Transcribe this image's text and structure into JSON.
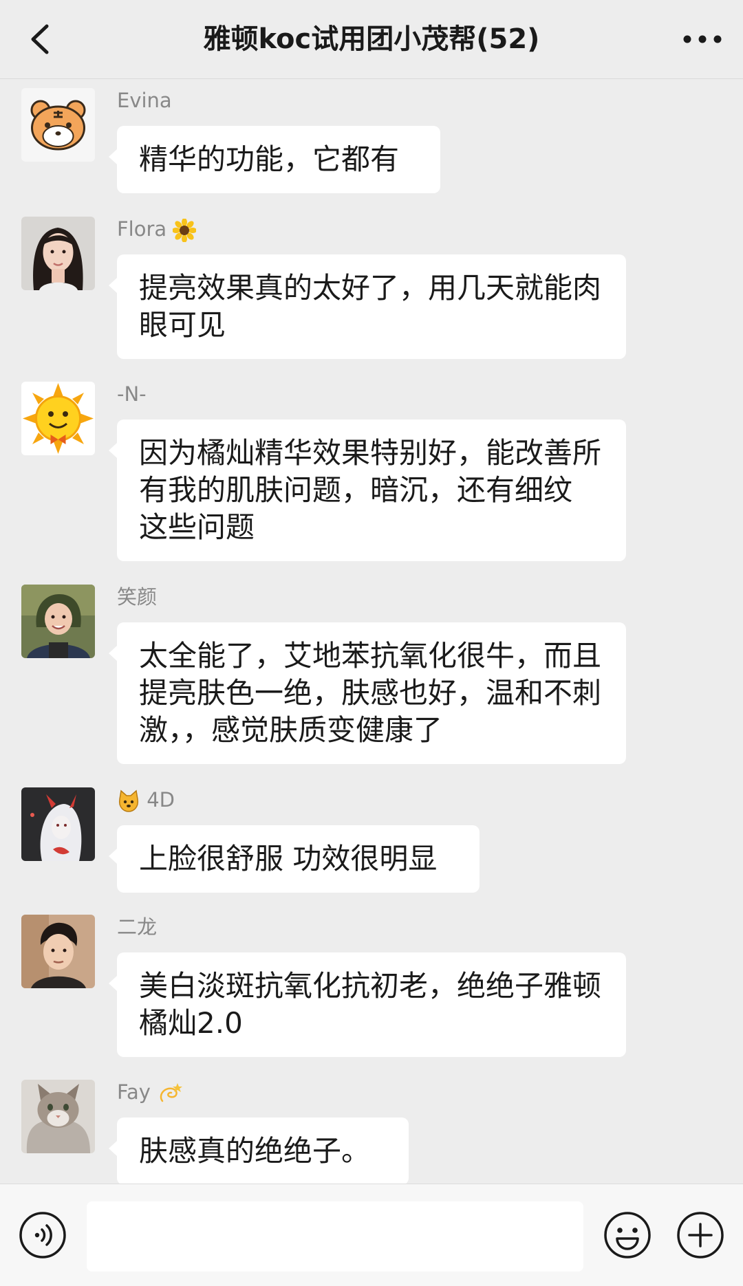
{
  "header": {
    "title": "雅顿koc试用团小茂帮(52)",
    "back_icon": "chevron-left-icon",
    "more_icon": "more-horizontal-icon"
  },
  "messages": [
    {
      "sender": "Evina",
      "text": "精华的功能，它都有",
      "avatar": "tiger-avatar"
    },
    {
      "sender": "Flora",
      "sender_emoji": "sunflower",
      "text": "提亮效果真的太好了，用几天就能肉眼可见",
      "avatar": "woman-portrait-avatar"
    },
    {
      "sender": "-N-",
      "text": "因为橘灿精华效果特别好，能改善所有我的肌肤问题，暗沉，还有细纹 这些问题",
      "avatar": "sun-emoji-avatar"
    },
    {
      "sender": "笑颜",
      "text": "太全能了，艾地苯抗氧化很牛，而且提亮肤色一绝，肤感也好，温和不刺激，，感觉肤质变健康了",
      "avatar": "girl-photo-avatar"
    },
    {
      "sender": "4D",
      "sender_emoji": "cat-face",
      "text": "上脸很舒服 功效很明显",
      "avatar": "demon-art-avatar"
    },
    {
      "sender": "二龙",
      "text": "美白淡斑抗氧化抗初老，绝绝子雅顿橘灿2.0",
      "avatar": "man-portrait-avatar"
    },
    {
      "sender": "Fay",
      "sender_emoji": "dizzy",
      "text": "肤感真的绝绝子。",
      "avatar": "cat-photo-avatar"
    }
  ],
  "input_bar": {
    "placeholder": "",
    "voice_icon": "voice-icon",
    "emoji_icon": "emoji-icon",
    "plus_icon": "plus-icon"
  },
  "colors": {
    "background": "#ededed",
    "bubble": "#ffffff",
    "sender_name": "#888888"
  }
}
